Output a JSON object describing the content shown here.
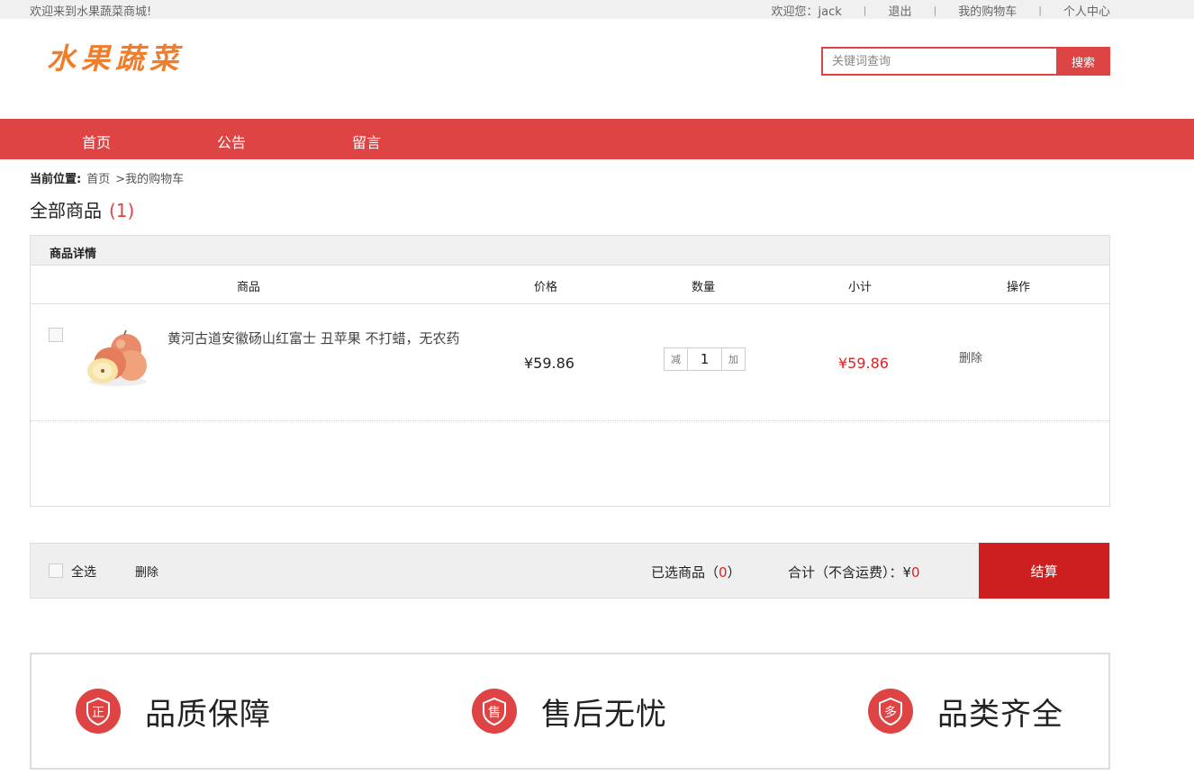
{
  "topbar": {
    "welcome": "欢迎来到水果蔬菜商城!",
    "greeting": "欢迎您：jack",
    "logout": "退出",
    "my_cart": "我的购物车",
    "profile": "个人中心",
    "separator": "|"
  },
  "logo": {
    "text": "水果蔬菜"
  },
  "search": {
    "placeholder": "关键词查询",
    "button": "搜索"
  },
  "nav": {
    "items": [
      "首页",
      "公告",
      "留言"
    ]
  },
  "breadcrumb": {
    "label": "当前位置:",
    "home": "首页",
    "current": ">我的购物车"
  },
  "cart": {
    "title": "全部商品",
    "count": "(1)",
    "section_header": "商品详情",
    "columns": {
      "product": "商品",
      "price": "价格",
      "quantity": "数量",
      "subtotal": "小计",
      "action": "操作"
    },
    "items": [
      {
        "name": "黄河古道安徽砀山红富士 丑苹果 不打蜡，无农药",
        "price": "¥59.86",
        "decrease": "减",
        "quantity": "1",
        "increase": "加",
        "subtotal": "¥59.86",
        "delete": "删除"
      }
    ]
  },
  "summary": {
    "select_all": "全选",
    "delete": "删除",
    "selected_label": "已选商品（",
    "selected_count": "0",
    "selected_close": "）",
    "total_label": "合计（不含运费）：¥",
    "total_value": "0",
    "checkout": "结算"
  },
  "guarantees": [
    {
      "icon": "zheng-badge-icon",
      "glyph": "正",
      "label": "品质保障"
    },
    {
      "icon": "shou-badge-icon",
      "glyph": "售",
      "label": "售后无忧"
    },
    {
      "icon": "duo-badge-icon",
      "glyph": "多",
      "label": "品类齐全"
    }
  ],
  "colors": {
    "accent": "#de4444",
    "checkout": "#cd1f1f",
    "price_red": "#dd2222",
    "logo": "#f07d2a"
  }
}
